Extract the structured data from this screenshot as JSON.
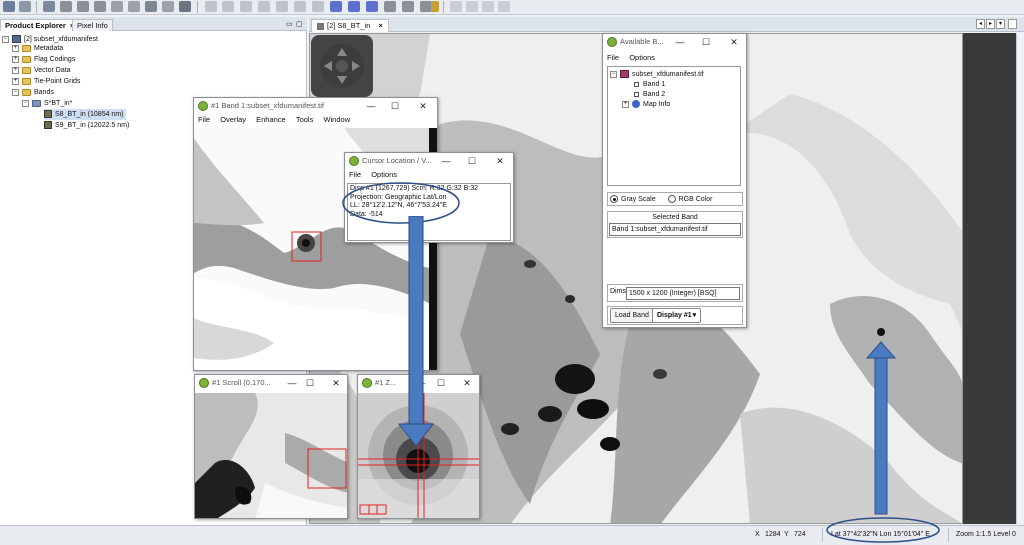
{
  "left_panel": {
    "tabs": [
      {
        "label": "Product Explorer",
        "close": "×"
      },
      {
        "label": "Pixel Info"
      }
    ],
    "tree": {
      "product": "[2] subset_xfdumanifest",
      "metadata": "Metadata",
      "flag_codings": "Flag Codings",
      "vector_data": "Vector Data",
      "tie_point_grids": "Tie-Point Grids",
      "bands": "Bands",
      "band_group": "S*BT_in*",
      "band1": "S8_BT_in (10854 nm)",
      "band2": "S9_BT_in (12022.5 nm)"
    }
  },
  "view": {
    "tab_label": "[2] S8_BT_in",
    "tab_close": "×"
  },
  "band_window": {
    "title": "#1 Band 1:subset_xfdumanifest.tif",
    "menu": [
      "File",
      "Overlay",
      "Enhance",
      "Tools",
      "Window"
    ]
  },
  "cursor_window": {
    "title": "Cursor Location / V...",
    "menu": [
      "File",
      "Options"
    ],
    "lines": [
      "Disp #1 (1267,729) Scrn: R:32 G:32 B:32",
      "Projection: Geographic Lat/Lon",
      "LL: 28°12'2.12\"N, 46°7'53.24\"E",
      "Data: -514"
    ]
  },
  "scroll_window": {
    "title": "#1 Scroll (0.170..."
  },
  "zoom_window": {
    "title": "#1 Z..."
  },
  "available_bands": {
    "title": "Available B...",
    "menu": [
      "File",
      "Options"
    ],
    "file": "subset_xfdumanifest.tif",
    "bands": [
      "Band 1",
      "Band 2"
    ],
    "map_info": "Map Info",
    "gray_scale": "Gray Scale",
    "rgb_color": "RGB Color",
    "selected_band_label": "Selected Band",
    "selected_band_value": "Band 1:subset_xfdumanifest.tif",
    "dims_label": "Dims",
    "dims_value": "1500 x 1200 (Integer) [BSQ]",
    "load_band": "Load Band",
    "display": "Display #1"
  },
  "window_controls": {
    "minimize": "—",
    "maximize": "☐",
    "close": "✕"
  },
  "statusbar": {
    "x_label": "X",
    "x_value": "1284",
    "y_label": "Y",
    "y_value": "724",
    "latlon": "Lat 37°42'32\"N  Lon 15°01'04\" E",
    "zoom": "Zoom 1:1.5  Level 0"
  },
  "colors": {
    "annotation_blue": "#4a7ac0",
    "annotation_outline": "#2e4e86",
    "red_marker": "#e02020"
  }
}
